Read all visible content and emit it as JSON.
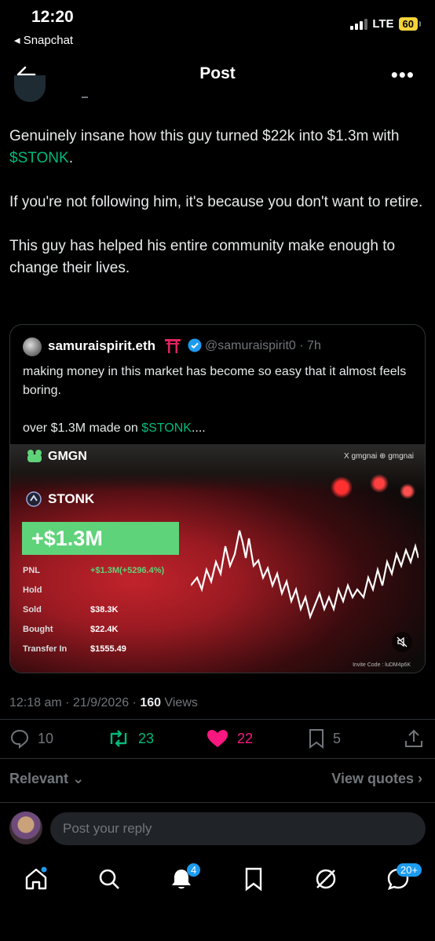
{
  "status": {
    "time": "12:20",
    "back_app": "◂ Snapchat",
    "network": "LTE",
    "battery": "60"
  },
  "header": {
    "title": "Post"
  },
  "post": {
    "paragraphs": [
      {
        "text": "Genuinely insane how this guy turned $22k into $1.3m with ",
        "cashtag": "$STONK",
        "suffix": "."
      },
      {
        "text": "If you're not following him, it's because you don't want to retire."
      },
      {
        "text": "This guy has helped his entire community make enough to change their lives."
      }
    ]
  },
  "quote": {
    "name": "samuraispirit.eth",
    "handle": "@samuraispirit0 · 7h",
    "line1": "making money in this market has become so easy that it almost feels boring.",
    "line2_prefix": "over $1.3M made on ",
    "line2_cashtag": "$STONK",
    "line2_suffix": "....",
    "media": {
      "brand": "GMGN",
      "tags": "X gmgnai   ⊕ gmgnai",
      "token": "STONK",
      "gain": "+$1.3M",
      "rows": [
        {
          "label": "PNL",
          "value": "+$1.3M(+5296.4%)"
        },
        {
          "label": "Hold",
          "value": ""
        },
        {
          "label": "Sold",
          "value": "$38.3K"
        },
        {
          "label": "Bought",
          "value": "$22.4K"
        },
        {
          "label": "Transfer In",
          "value": "$1555.49"
        }
      ],
      "invite": "Invite Code : luDM4p6K"
    }
  },
  "meta": {
    "time": "12:18 am · 21/9/2026 · ",
    "views": "160",
    "views_label": " Views"
  },
  "actions": {
    "replies": "10",
    "reposts": "23",
    "likes": "22",
    "bookmarks": "5"
  },
  "colors": {
    "repost": "#00ba7c",
    "like": "#f91880",
    "accent": "#1d9bf0"
  },
  "sort": {
    "relevant": "Relevant",
    "view_quotes": "View quotes"
  },
  "reply": {
    "placeholder": "Post your reply"
  },
  "nav": {
    "notifications_badge": "4",
    "messages_badge": "20+"
  }
}
